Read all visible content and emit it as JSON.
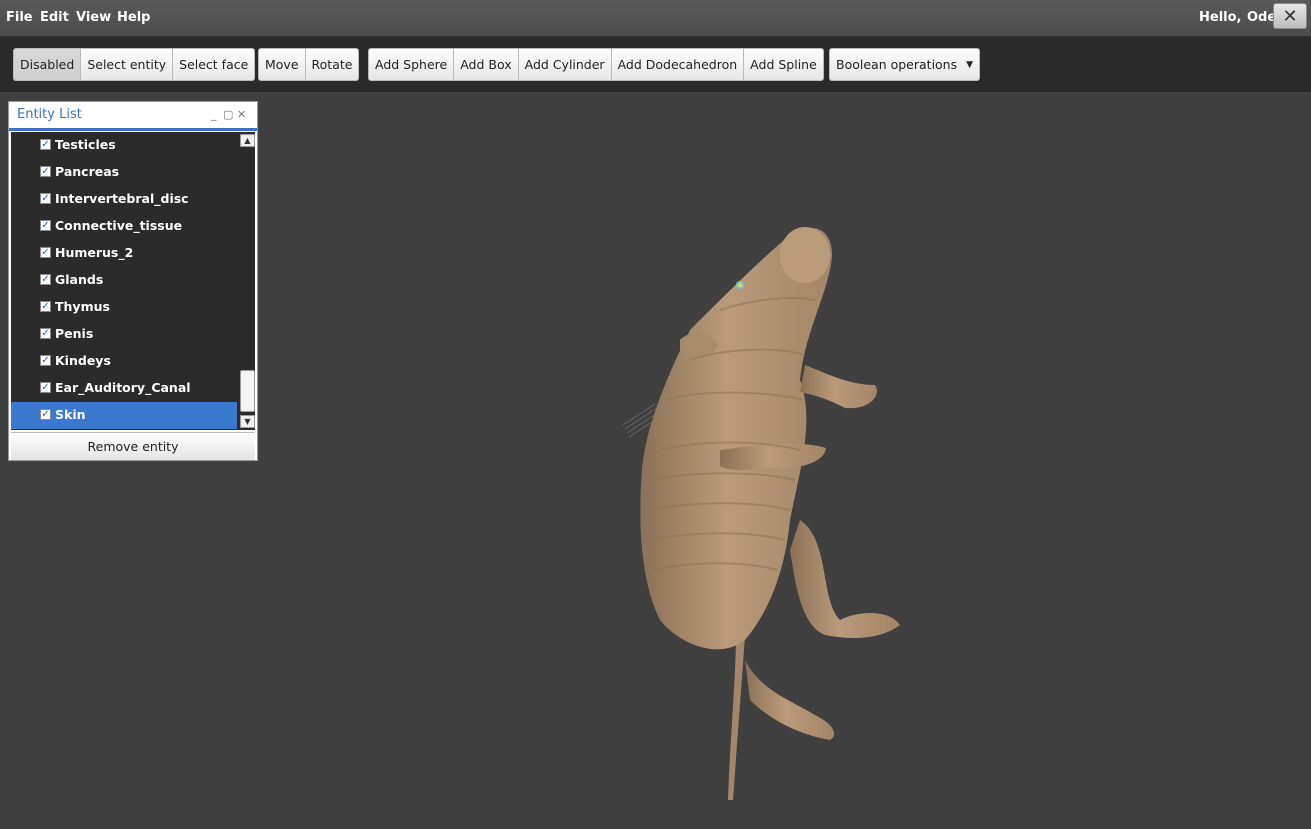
{
  "menu": {
    "items": [
      "File",
      "Edit",
      "View",
      "Help"
    ],
    "greeting": "Hello,",
    "username": "Ode"
  },
  "toolbar": {
    "mode_group": [
      "Disabled",
      "Select entity",
      "Select face"
    ],
    "transform_group": [
      "Move",
      "Rotate"
    ],
    "add_group": [
      "Add Sphere",
      "Add Box",
      "Add Cylinder",
      "Add Dodecahedron",
      "Add Spline"
    ],
    "boolean_label": "Boolean operations"
  },
  "entity_panel": {
    "title": "Entity List",
    "items": [
      {
        "label": "Testicles",
        "checked": true
      },
      {
        "label": "Pancreas",
        "checked": true
      },
      {
        "label": "Intervertebral_disc",
        "checked": true
      },
      {
        "label": "Connective_tissue",
        "checked": true
      },
      {
        "label": "Humerus_2",
        "checked": true
      },
      {
        "label": "Glands",
        "checked": true
      },
      {
        "label": "Thymus",
        "checked": true
      },
      {
        "label": "Penis",
        "checked": true
      },
      {
        "label": "Kindeys",
        "checked": true
      },
      {
        "label": "Ear_Auditory_Canal",
        "checked": true
      },
      {
        "label": "Skin",
        "checked": true,
        "selected": true
      }
    ],
    "remove_label": "Remove entity"
  },
  "viewport": {
    "background": "#404040",
    "model_color": "#b79a79"
  }
}
